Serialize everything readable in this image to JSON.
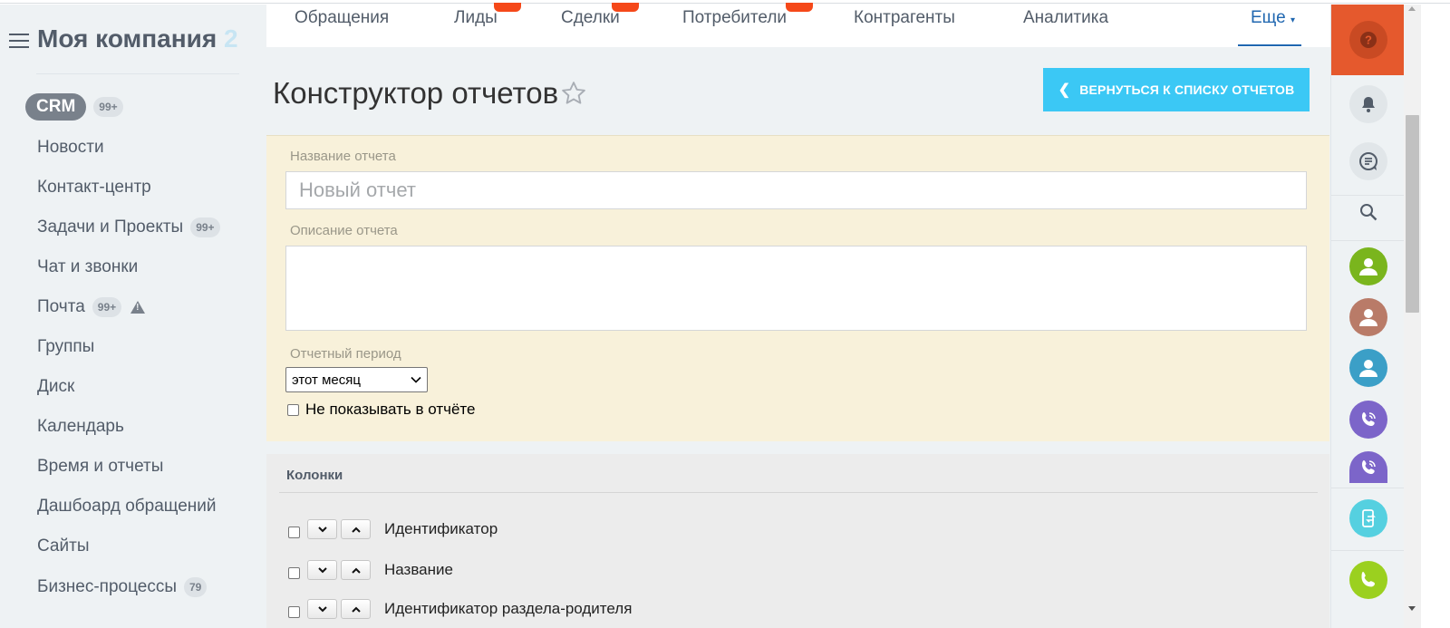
{
  "sidebar": {
    "company": "Моя компания",
    "company_fade": "2",
    "crm_label": "CRM",
    "crm_counter": "99+",
    "items": [
      {
        "label": "Новости",
        "counter": ""
      },
      {
        "label": "Контакт-центр",
        "counter": ""
      },
      {
        "label": "Задачи и Проекты",
        "counter": "99+"
      },
      {
        "label": "Чат и звонки",
        "counter": ""
      },
      {
        "label": "Почта",
        "counter": "99+"
      },
      {
        "label": "Группы",
        "counter": ""
      },
      {
        "label": "Диск",
        "counter": ""
      },
      {
        "label": "Календарь",
        "counter": ""
      },
      {
        "label": "Время и отчеты",
        "counter": ""
      },
      {
        "label": "Дашбоард обращений",
        "counter": ""
      },
      {
        "label": "Сайты",
        "counter": ""
      },
      {
        "label": "Бизнес-процессы",
        "counter": "79"
      }
    ]
  },
  "topnav": {
    "items": [
      "Обращения",
      "Лиды",
      "Сделки",
      "Потребители",
      "Контрагенты",
      "Аналитика"
    ],
    "more": "Еще"
  },
  "page": {
    "title": "Конструктор отчетов",
    "back_button": "ВЕРНУТЬСЯ К СПИСКУ ОТЧЕТОВ"
  },
  "form": {
    "name_label": "Название отчета",
    "name_placeholder": "Новый отчет",
    "description_label": "Описание отчета",
    "period_label": "Отчетный период",
    "period_value": "этот месяц",
    "hide_label": "Не показывать в отчёте"
  },
  "columns": {
    "title": "Колонки",
    "items": [
      "Идентификатор",
      "Название",
      "Идентификатор раздела-родителя"
    ]
  },
  "colors": {
    "accent": "#3bc8f5",
    "help": "#e5592d",
    "brand_text": "#525c69",
    "nav_active": "#2067b0",
    "form_bg": "#f8f1da"
  }
}
